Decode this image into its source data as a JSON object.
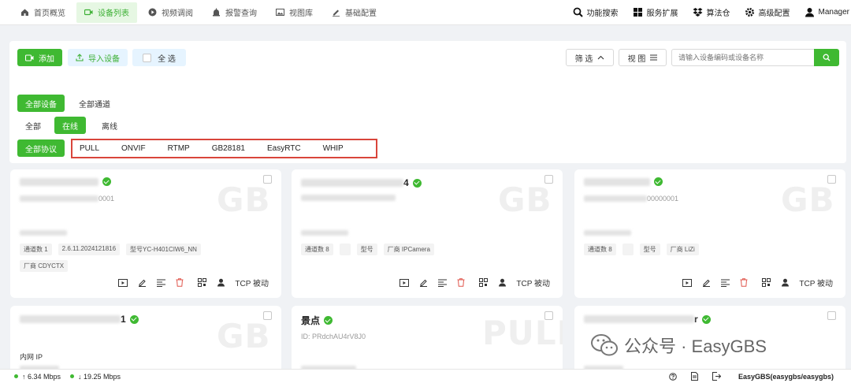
{
  "nav": {
    "items": [
      {
        "label": "首页概览",
        "icon": "home-icon"
      },
      {
        "label": "设备列表",
        "icon": "camera-icon",
        "active": true
      },
      {
        "label": "视频调阅",
        "icon": "play-circle-icon"
      },
      {
        "label": "报警查询",
        "icon": "alarm-icon"
      },
      {
        "label": "视图库",
        "icon": "image-icon"
      },
      {
        "label": "基础配置",
        "icon": "edit-icon"
      }
    ],
    "right": [
      {
        "label": "功能搜索",
        "icon": "search-icon"
      },
      {
        "label": "服务扩展",
        "icon": "grid-icon"
      },
      {
        "label": "算法仓",
        "icon": "dropbox-icon"
      },
      {
        "label": "高级配置",
        "icon": "gear-icon"
      },
      {
        "label": "Manager",
        "icon": "user-icon"
      }
    ]
  },
  "toolbar": {
    "add": "添加",
    "import": "导入设备",
    "select_all": "全 选",
    "filter": "筛 选",
    "view": "视 图",
    "search_placeholder": "请输入设备编码或设备名称"
  },
  "filters": {
    "type_all_devices": "全部设备",
    "type_all_channels": "全部通道",
    "status_all": "全部",
    "status_online": "在线",
    "status_offline": "离线",
    "protocol_all": "全部协议",
    "protocols": [
      "PULL",
      "ONVIF",
      "RTMP",
      "GB28181",
      "EasyRTC",
      "WHIP"
    ]
  },
  "cards": [
    {
      "watermark": "GB",
      "title_suffix": "",
      "id_suffix": "0001",
      "tags": [
        "通道数 1",
        "2.6.11.2024121816",
        "型号YC-H401CIW6_NN",
        "厂商 CDYCTX"
      ],
      "mode": "TCP 被动"
    },
    {
      "watermark": "GB",
      "title_suffix": "4",
      "id_suffix": "",
      "tags": [
        "通道数 8",
        "",
        "型号",
        "厂商 IPCamera"
      ],
      "mode": "TCP 被动"
    },
    {
      "watermark": "GB",
      "title_suffix": "",
      "id_suffix": "00000001",
      "tags": [
        "通道数 8",
        "",
        "型号",
        "厂商 LiZi"
      ],
      "mode": "TCP 被动"
    },
    {
      "watermark": "GB",
      "title_suffix": "1",
      "line1": "内网 IP"
    },
    {
      "watermark": "PULL",
      "title": "景点",
      "id": "ID: PRdchAU4rV8J0"
    },
    {
      "watermark": "GB",
      "title_suffix": "r",
      "line1": ""
    }
  ],
  "status": {
    "up": "↑ 6.34 Mbps",
    "down": "↓ 19.25 Mbps",
    "account": "EasyGBS(easygbs/easygbs)"
  },
  "overlay": {
    "text": "公众号 · EasyGBS"
  },
  "colors": {
    "accent": "#3fb932",
    "highlight_border": "#d9453b"
  }
}
